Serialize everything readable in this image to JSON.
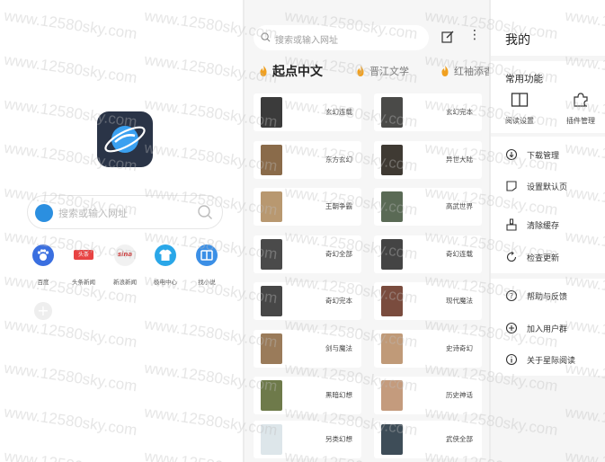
{
  "home": {
    "search_placeholder": "搜索或输入网址",
    "shortcuts": [
      {
        "label": "百度",
        "icon": "baidu-paw-icon",
        "color": "#3a6fe0"
      },
      {
        "label": "头条新闻",
        "icon": "toutiao-icon",
        "color": "#e84343",
        "badge": "头条"
      },
      {
        "label": "新浪新闻",
        "icon": "sina-icon",
        "color": "#f1f1f1",
        "badge": "sina"
      },
      {
        "label": "极电中心",
        "icon": "tshirt-icon",
        "color": "#2aa7e8"
      },
      {
        "label": "找小说",
        "icon": "book-icon",
        "color": "#3b8fe6"
      }
    ],
    "add_symbol": "+"
  },
  "qidian": {
    "search_placeholder": "搜索或输入网址",
    "more_symbol": "⋮",
    "tabs": [
      {
        "label": "起点中文",
        "active": true
      },
      {
        "label": "晋江文学",
        "active": false
      },
      {
        "label": "红袖添香",
        "active": false
      }
    ],
    "books": [
      {
        "title": "玄幻连载",
        "cover": "#3b3b3b"
      },
      {
        "title": "玄幻完本",
        "cover": "#4a4a48"
      },
      {
        "title": "东方玄幻",
        "cover": "#8a6b4a"
      },
      {
        "title": "异世大陆",
        "cover": "#3f3a33"
      },
      {
        "title": "王朝争霸",
        "cover": "#b89870"
      },
      {
        "title": "高武世界",
        "cover": "#5a6a55"
      },
      {
        "title": "奇幻全部",
        "cover": "#4a4a4a"
      },
      {
        "title": "奇幻连载",
        "cover": "#444444"
      },
      {
        "title": "奇幻完本",
        "cover": "#474747"
      },
      {
        "title": "现代魔法",
        "cover": "#7a4c3e"
      },
      {
        "title": "剑与魔法",
        "cover": "#9a7b5a"
      },
      {
        "title": "史诗奇幻",
        "cover": "#c09a78"
      },
      {
        "title": "黑暗幻想",
        "cover": "#6e7a4a"
      },
      {
        "title": "历史神话",
        "cover": "#c49b7d"
      },
      {
        "title": "另类幻想",
        "cover": "#dde6ea"
      },
      {
        "title": "武侠全部",
        "cover": "#3e4d58"
      }
    ]
  },
  "mine": {
    "title": "我的",
    "section_label": "常用功能",
    "quick_actions": [
      {
        "label": "阅读设置",
        "icon": "book-open-icon"
      },
      {
        "label": "插件管理",
        "icon": "puzzle-icon"
      }
    ],
    "menu_group1": [
      {
        "label": "下载管理",
        "icon": "download-icon"
      },
      {
        "label": "设置默认页",
        "icon": "bookmark-icon"
      },
      {
        "label": "清除缓存",
        "icon": "broom-icon"
      },
      {
        "label": "检查更新",
        "icon": "refresh-icon"
      }
    ],
    "menu_group2": [
      {
        "label": "帮助与反馈",
        "icon": "help-icon"
      },
      {
        "label": "加入用户群",
        "icon": "add-group-icon"
      },
      {
        "label": "关于星际阅读",
        "icon": "info-icon"
      }
    ]
  },
  "watermark": "www.12580sky.com"
}
